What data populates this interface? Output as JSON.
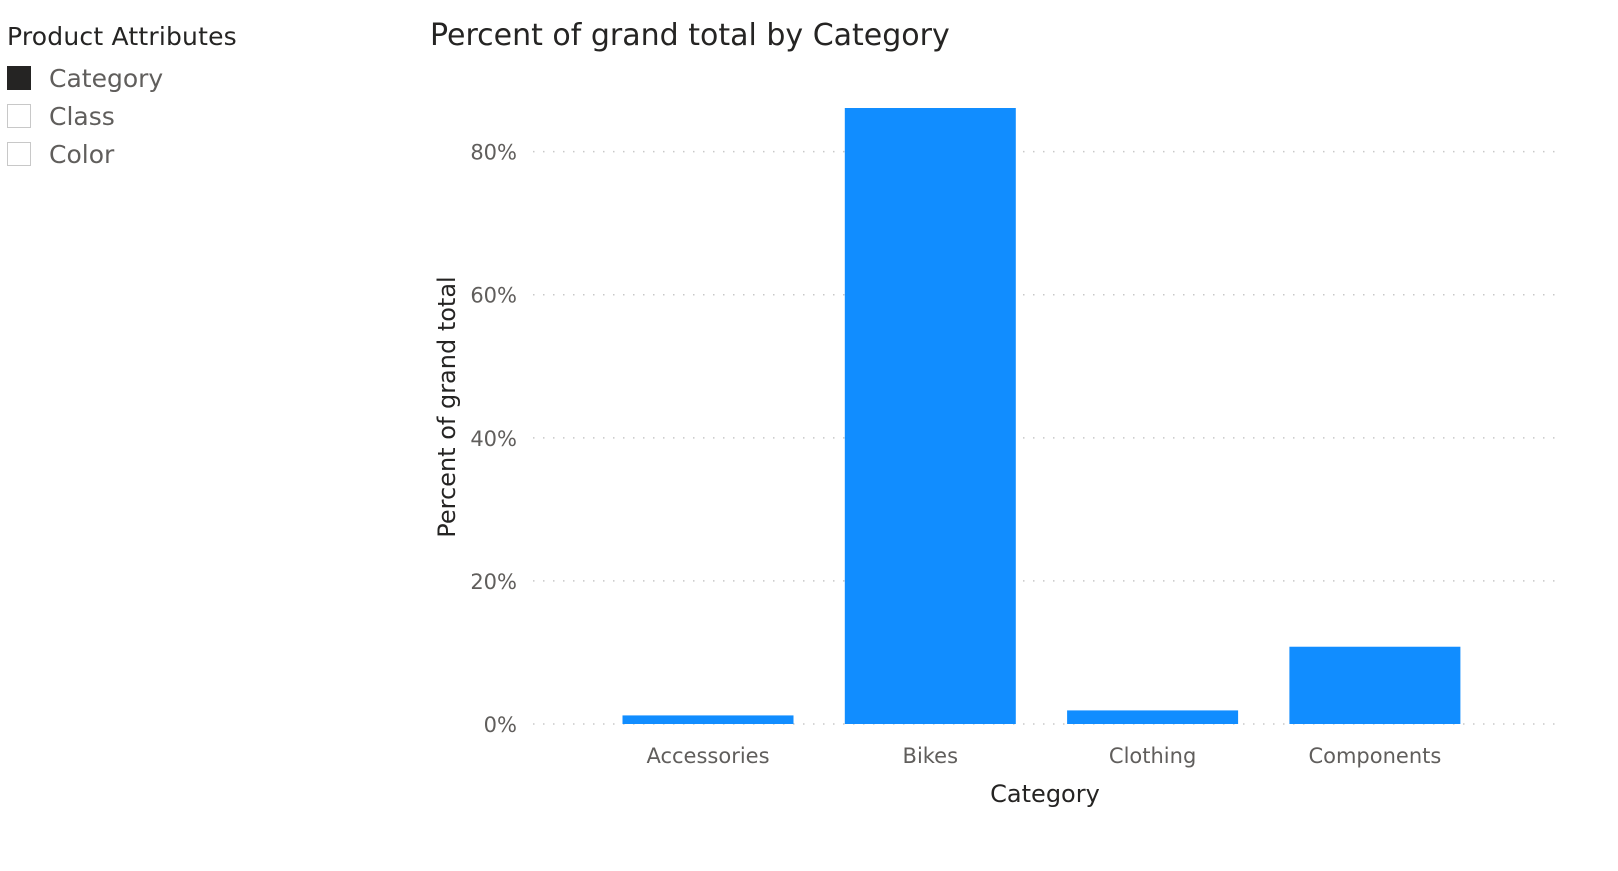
{
  "slicer": {
    "title": "Product Attributes",
    "items": [
      {
        "label": "Category",
        "checked": true
      },
      {
        "label": "Class",
        "checked": false
      },
      {
        "label": "Color",
        "checked": false
      }
    ]
  },
  "chart_data": {
    "type": "bar",
    "title": "Percent of grand total by Category",
    "xlabel": "Category",
    "ylabel": "Percent of grand total",
    "categories": [
      "Accessories",
      "Bikes",
      "Clothing",
      "Components"
    ],
    "values": [
      1.2,
      86.1,
      1.9,
      10.8
    ],
    "unit": "%",
    "ylim": [
      0,
      86.1
    ],
    "yticks": [
      0,
      20,
      40,
      60,
      80
    ],
    "ytick_labels": [
      "0%",
      "20%",
      "40%",
      "60%",
      "80%"
    ],
    "grid": true,
    "bar_color": "#118DFF",
    "legend": "none"
  }
}
